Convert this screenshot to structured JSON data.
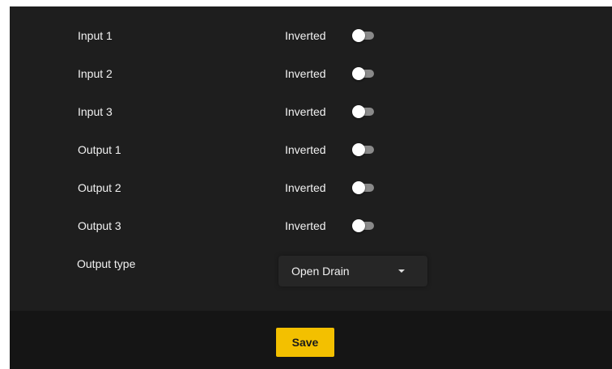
{
  "colors": {
    "panel_bg": "#1e1e1e",
    "footer_bg": "#151515",
    "accent": "#f3c000",
    "text": "#f2f2f2",
    "switch_track": "#8a8a8a",
    "switch_thumb": "#ffffff"
  },
  "rows": [
    {
      "label": "Input 1",
      "toggle_label": "Inverted",
      "toggle_on": false
    },
    {
      "label": "Input 2",
      "toggle_label": "Inverted",
      "toggle_on": false
    },
    {
      "label": "Input 3",
      "toggle_label": "Inverted",
      "toggle_on": false
    },
    {
      "label": "Output 1",
      "toggle_label": "Inverted",
      "toggle_on": false
    },
    {
      "label": "Output 2",
      "toggle_label": "Inverted",
      "toggle_on": false
    },
    {
      "label": "Output 3",
      "toggle_label": "Inverted",
      "toggle_on": false
    }
  ],
  "output_type": {
    "label": "Output type",
    "selected": "Open Drain",
    "icon": "chevron-down-icon"
  },
  "footer": {
    "save_label": "Save"
  }
}
